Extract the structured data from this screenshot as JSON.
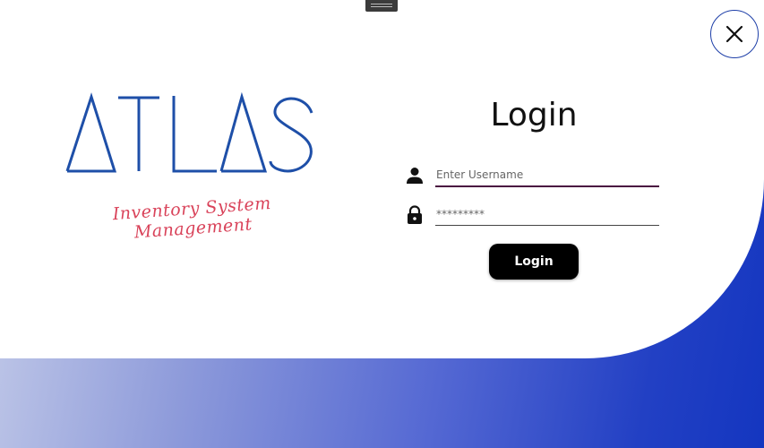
{
  "window": {
    "close_icon": "close-icon",
    "drag_handle_icon": "drag-handle-icon"
  },
  "branding": {
    "logo_text": "ATLAS",
    "tagline_line1": "Inventory System",
    "tagline_line2": "Management",
    "logo_color": "#1e4fa8",
    "tagline_color": "#d9435a"
  },
  "login": {
    "title": "Login",
    "username_placeholder": "Enter Username",
    "username_value": "",
    "username_icon": "user-icon",
    "password_placeholder": "*********",
    "password_value": "",
    "password_icon": "lock-icon",
    "submit_label": "Login"
  },
  "colors": {
    "background_gradient_start": "#c9d0ea",
    "background_gradient_end": "#1436c0",
    "button": "#000000"
  }
}
